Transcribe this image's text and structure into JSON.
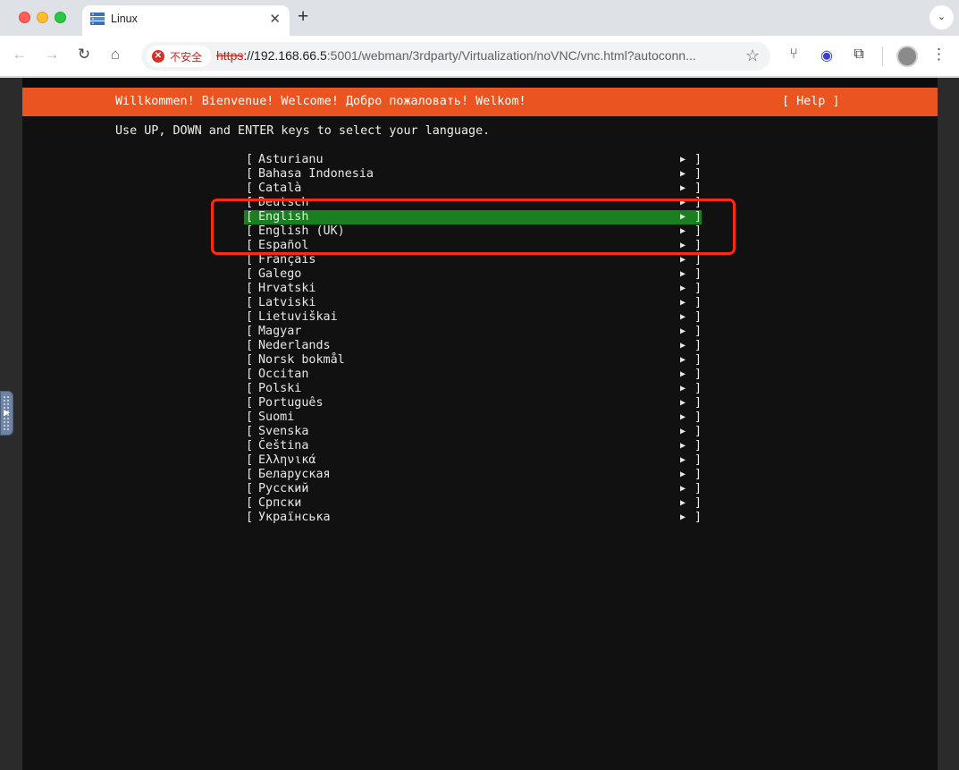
{
  "browser": {
    "tab": {
      "title": "Linux",
      "favicon": "server-icon"
    },
    "new_tab_glyph": "+",
    "tab_menu_glyph": "⌄",
    "security_label": "不安全",
    "url": {
      "scheme": "https",
      "host": "://192.168.66.5",
      "rest": ":5001/webman/3rdparty/Virtualization/noVNC/vnc.html?autoconn..."
    },
    "nav_icons": [
      "back-arrow-icon",
      "forward-arrow-icon",
      "reload-icon",
      "home-icon"
    ],
    "extension_icons": [
      "cutlery-icon",
      "record-icon",
      "puzzle-extension-icon"
    ],
    "colors": {
      "insecure": "#c5221f",
      "tab_bg": "#dee1e6"
    }
  },
  "installer": {
    "header_title": "Willkommen! Bienvenue! Welcome! Добро пожаловать! Welkom!",
    "help_label": "[ Help ]",
    "instructions": "Use UP, DOWN and ENTER keys to select your language.",
    "bracket_open": "[",
    "bracket_close": "]",
    "arrow_glyph": "▶",
    "selected_language": "English",
    "languages": [
      {
        "label": "Asturianu"
      },
      {
        "label": "Bahasa Indonesia"
      },
      {
        "label": "Català"
      },
      {
        "label": "Deutsch"
      },
      {
        "label": "English"
      },
      {
        "label": "English (UK)"
      },
      {
        "label": "Español"
      },
      {
        "label": "Français"
      },
      {
        "label": "Galego"
      },
      {
        "label": "Hrvatski"
      },
      {
        "label": "Latviski"
      },
      {
        "label": "Lietuviškai"
      },
      {
        "label": "Magyar"
      },
      {
        "label": "Nederlands"
      },
      {
        "label": "Norsk bokmål"
      },
      {
        "label": "Occitan"
      },
      {
        "label": "Polski"
      },
      {
        "label": "Português"
      },
      {
        "label": "Suomi"
      },
      {
        "label": "Svenska"
      },
      {
        "label": "Čeština"
      },
      {
        "label": "Ελληνικά"
      },
      {
        "label": "Беларуская"
      },
      {
        "label": "Русский"
      },
      {
        "label": "Српски"
      },
      {
        "label": "Українська"
      }
    ],
    "colors": {
      "header": "#e95420",
      "selection": "#1a7f1f",
      "annotation": "#ff2a12"
    }
  }
}
